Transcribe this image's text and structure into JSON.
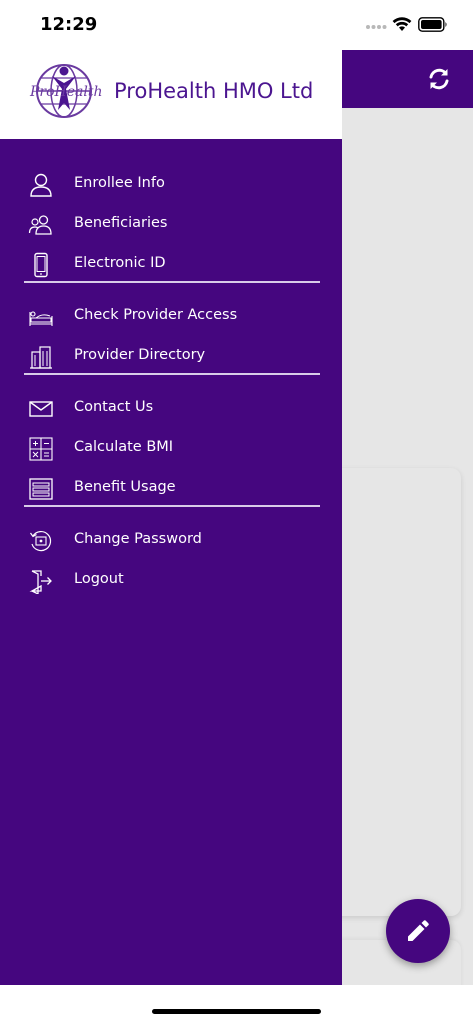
{
  "status_bar": {
    "time": "12:29"
  },
  "header": {
    "company_name": "ProHealth HMO Ltd",
    "logo_text": "ProHealth",
    "refresh_icon": "refresh-icon"
  },
  "menu": {
    "groups": [
      [
        {
          "label": "Enrollee Info",
          "icon": "person-icon"
        },
        {
          "label": "Beneficiaries",
          "icon": "people-icon"
        },
        {
          "label": "Electronic ID",
          "icon": "phone-icon"
        }
      ],
      [
        {
          "label": "Check Provider Access",
          "icon": "hospital-bed-icon"
        },
        {
          "label": "Provider Directory",
          "icon": "building-icon"
        }
      ],
      [
        {
          "label": "Contact Us",
          "icon": "envelope-icon"
        },
        {
          "label": "Calculate BMI",
          "icon": "calculator-icon"
        },
        {
          "label": "Benefit Usage",
          "icon": "list-icon"
        }
      ],
      [
        {
          "label": "Change Password",
          "icon": "password-reset-icon"
        },
        {
          "label": "Logout",
          "icon": "logout-icon"
        }
      ]
    ]
  },
  "fab": {
    "icon": "pencil-icon"
  },
  "colors": {
    "brand": "#45067f",
    "logo_text": "#4b1590",
    "background": "#e6e6e6"
  }
}
